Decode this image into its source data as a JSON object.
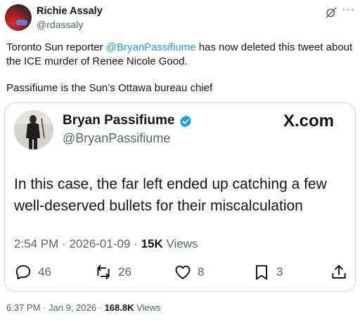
{
  "post": {
    "author_name": "Richie Assaly",
    "author_handle": "@rdassaly",
    "text_part1": "Toronto Sun reporter ",
    "mention": "@BryanPassifiume",
    "text_part2": " has now deleted this tweet about the ICE murder of Renee Nicole Good.",
    "text_line2": "Passifiume is the Sun’s Ottawa bureau chief",
    "time": "6:37 PM",
    "date": "Jan 9, 2026",
    "views_count": "168.8K",
    "views_label": "Views",
    "separator": "·"
  },
  "quote": {
    "author_name": "Bryan Passifiume",
    "author_handle": "@BryanPassifiume",
    "brand": "X.com",
    "text": "In this case, the far left ended up catching a few well-deserved bullets for their miscalculation",
    "time": "2:54 PM",
    "date": "2026-01-09",
    "views_count": "15K",
    "views_label": "Views",
    "separator": "·",
    "replies": "46",
    "reposts": "26",
    "likes": "8",
    "bookmarks": "3"
  },
  "colors": {
    "accent": "#1d9bf0",
    "secondary_text": "#536471",
    "border": "#cfd9de"
  },
  "icons": [
    "grok-icon",
    "more-icon",
    "verified-badge-icon",
    "reply-icon",
    "repost-icon",
    "like-icon",
    "bookmark-icon",
    "share-icon"
  ]
}
